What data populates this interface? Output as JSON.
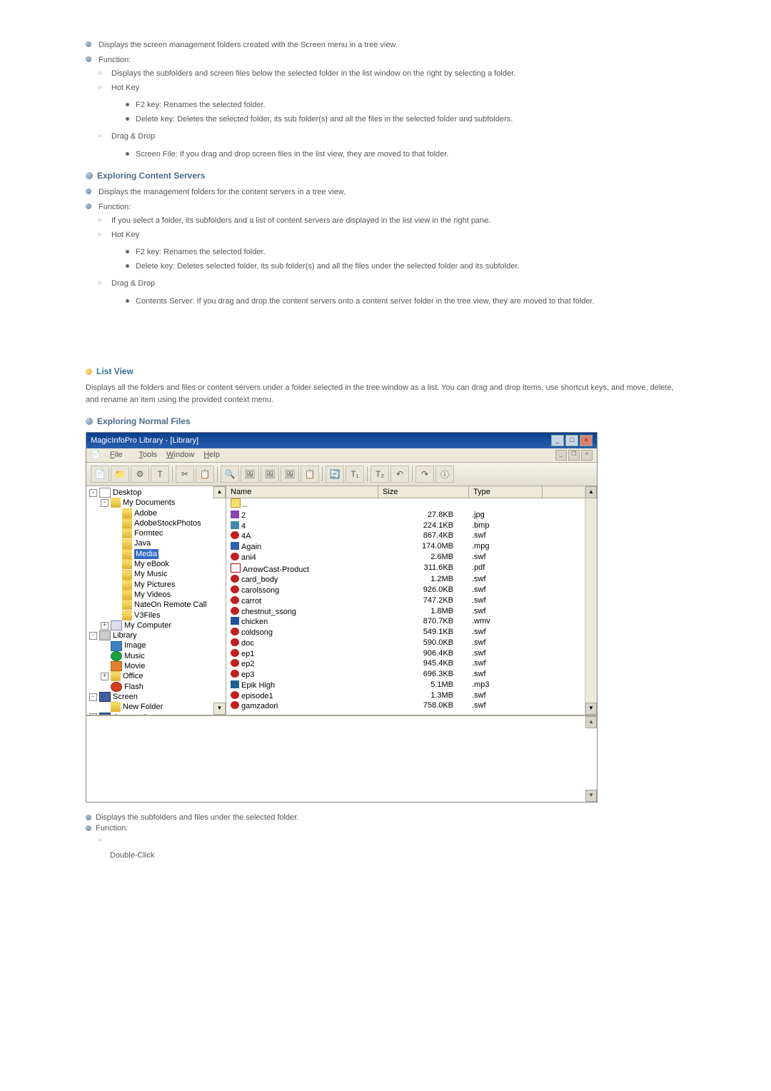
{
  "section1": {
    "bullets": [
      "Displays the screen management folders created with the Screen menu in a tree view.",
      "Function:"
    ],
    "sub": [
      "Displays the subfolders and screen files below the selected folder in the list window on the right by selecting a folder.",
      "Hot Key"
    ],
    "hotkey_dots": [
      "F2 key: Renames the selected folder.",
      "Delete key: Deletes the selected folder, its sub folder(s) and all the files in the selected folder and subfolders."
    ],
    "drag": "Drag & Drop",
    "drag_dots": [
      "Screen File: If you drag and drop screen files in the list view, they are moved to that folder."
    ]
  },
  "section2": {
    "title": "Exploring Content Servers",
    "bullets": [
      "Displays the management folders for the content servers in a tree view.",
      "Function:"
    ],
    "sub": [
      "If you select a folder, its subfolders and a list of content servers are displayed in the list view in the right pane.",
      "Hot Key"
    ],
    "hotkey_dots": [
      "F2 key: Renames the selected folder.",
      "Delete key: Deletes selected folder, its sub folder(s) and all the files under the selected folder and its subfolder."
    ],
    "drag": "Drag & Drop",
    "drag_dots": [
      "Contents Server: If you drag and drop the content servers onto a content server folder in the tree view, they are moved to that folder."
    ]
  },
  "listview": {
    "title": "List View",
    "desc": "Displays all the folders and files or content servers under a folder selected in the tree window as a list. You can drag and drop items, use shortcut keys, and move, delete, and rename an item using the provided context menu.",
    "subtitle": "Exploring Normal Files"
  },
  "app": {
    "title": "MagicInfoPro Library - [Library]",
    "menu": {
      "file": "File",
      "tools": "Tools",
      "window": "Window",
      "help": "Help"
    },
    "toolbar_icons": [
      "📄",
      "📁",
      "⚙",
      "T",
      "✂",
      "📋",
      "🔍",
      "🖼",
      "🖼",
      "🖼",
      "📋",
      "🔄",
      "T₁",
      "T₂",
      "↶",
      "↷",
      "ⓘ"
    ],
    "columns": {
      "name": "Name",
      "size": "Size",
      "type": "Type"
    },
    "tree": [
      {
        "ind": 0,
        "exp": "-",
        "icon": "desktop-icon",
        "label": "Desktop"
      },
      {
        "ind": 1,
        "exp": "-",
        "icon": "folder-icon",
        "label": "My Documents"
      },
      {
        "ind": 2,
        "exp": " ",
        "icon": "folder-icon",
        "label": "Adobe"
      },
      {
        "ind": 2,
        "exp": " ",
        "icon": "folder-icon",
        "label": "AdobeStockPhotos"
      },
      {
        "ind": 2,
        "exp": " ",
        "icon": "folder-icon",
        "label": "Formtec"
      },
      {
        "ind": 2,
        "exp": " ",
        "icon": "folder-icon",
        "label": "Java"
      },
      {
        "ind": 2,
        "exp": " ",
        "icon": "folder-icon",
        "label": "Media",
        "hl": true
      },
      {
        "ind": 2,
        "exp": " ",
        "icon": "folder-icon",
        "label": "My eBook"
      },
      {
        "ind": 2,
        "exp": " ",
        "icon": "folder-icon",
        "label": "My Music"
      },
      {
        "ind": 2,
        "exp": " ",
        "icon": "folder-icon",
        "label": "My Pictures"
      },
      {
        "ind": 2,
        "exp": " ",
        "icon": "folder-icon",
        "label": "My Videos"
      },
      {
        "ind": 2,
        "exp": " ",
        "icon": "folder-icon",
        "label": "NateOn Remote Call"
      },
      {
        "ind": 2,
        "exp": " ",
        "icon": "folder-icon",
        "label": "V3Files"
      },
      {
        "ind": 1,
        "exp": "+",
        "icon": "computer-icon",
        "label": "My Computer"
      },
      {
        "ind": 0,
        "exp": "-",
        "icon": "drive-icon",
        "label": "Library"
      },
      {
        "ind": 1,
        "exp": " ",
        "icon": "blue-icon",
        "label": "Image"
      },
      {
        "ind": 1,
        "exp": " ",
        "icon": "green-icon",
        "label": "Music"
      },
      {
        "ind": 1,
        "exp": " ",
        "icon": "orange-icon",
        "label": "Movie"
      },
      {
        "ind": 1,
        "exp": "+",
        "icon": "folder-icon",
        "label": "Office"
      },
      {
        "ind": 1,
        "exp": " ",
        "icon": "red-icon",
        "label": "Flash"
      },
      {
        "ind": 0,
        "exp": "-",
        "icon": "screen-icon",
        "label": "Screen"
      },
      {
        "ind": 1,
        "exp": " ",
        "icon": "folder-icon",
        "label": "New Folder"
      },
      {
        "ind": 0,
        "exp": "+",
        "icon": "screen-icon",
        "label": "Content Server"
      }
    ],
    "files": [
      {
        "icon": "ico-up",
        "name": "..",
        "size": "",
        "type": ""
      },
      {
        "icon": "ico-jpg",
        "name": "2",
        "size": "27.8KB",
        "type": ".jpg"
      },
      {
        "icon": "ico-bmp",
        "name": "4",
        "size": "224.1KB",
        "type": ".bmp"
      },
      {
        "icon": "ico-swf",
        "name": "4A",
        "size": "867.4KB",
        "type": ".swf"
      },
      {
        "icon": "ico-mpg",
        "name": "Again",
        "size": "174.0MB",
        "type": ".mpg"
      },
      {
        "icon": "ico-swf",
        "name": "ani4",
        "size": "2.6MB",
        "type": ".swf"
      },
      {
        "icon": "ico-pdf",
        "name": "ArrowCast-Product",
        "size": "311.6KB",
        "type": ".pdf"
      },
      {
        "icon": "ico-swf",
        "name": "card_body",
        "size": "1.2MB",
        "type": ".swf"
      },
      {
        "icon": "ico-swf",
        "name": "carolssong",
        "size": "926.0KB",
        "type": ".swf"
      },
      {
        "icon": "ico-swf",
        "name": "carrot",
        "size": "747.2KB",
        "type": ".swf"
      },
      {
        "icon": "ico-swf",
        "name": "chestnut_ssong",
        "size": "1.8MB",
        "type": ".swf"
      },
      {
        "icon": "ico-wmv",
        "name": "chicken",
        "size": "870.7KB",
        "type": ".wmv"
      },
      {
        "icon": "ico-swf",
        "name": "coldsong",
        "size": "549.1KB",
        "type": ".swf"
      },
      {
        "icon": "ico-swf",
        "name": "doc",
        "size": "590.0KB",
        "type": ".swf"
      },
      {
        "icon": "ico-swf",
        "name": "ep1",
        "size": "906.4KB",
        "type": ".swf"
      },
      {
        "icon": "ico-swf",
        "name": "ep2",
        "size": "945.4KB",
        "type": ".swf"
      },
      {
        "icon": "ico-swf",
        "name": "ep3",
        "size": "696.3KB",
        "type": ".swf"
      },
      {
        "icon": "ico-mp3",
        "name": "Epik High",
        "size": "5.1MB",
        "type": ".mp3"
      },
      {
        "icon": "ico-swf",
        "name": "episode1",
        "size": "1.3MB",
        "type": ".swf"
      },
      {
        "icon": "ico-swf",
        "name": "gamzadori",
        "size": "758.0KB",
        "type": ".swf"
      }
    ]
  },
  "section3": {
    "b1": "Displays the subfolders and files under the selected folder.",
    "b2": "Function:",
    "sub": "Double-Click"
  }
}
